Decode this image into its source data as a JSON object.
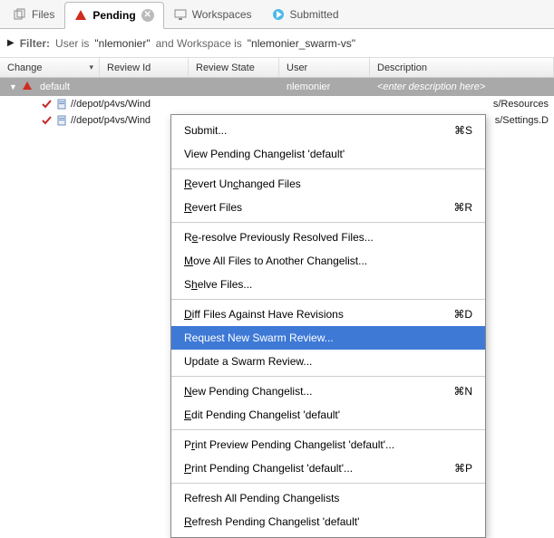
{
  "tabs": {
    "files": "Files",
    "pending": "Pending",
    "workspaces": "Workspaces",
    "submitted": "Submitted"
  },
  "filter": {
    "label": "Filter:",
    "text1": "User is",
    "val1": "\"nlemonier\"",
    "text2": "and Workspace is",
    "val2": "\"nlemonier_swarm-vs\""
  },
  "headers": {
    "change": "Change",
    "review": "Review Id",
    "state": "Review State",
    "user": "User",
    "desc": "Description"
  },
  "group": {
    "name": "default",
    "user": "nlemonier",
    "desc": "<enter description here>"
  },
  "files": [
    {
      "path": "//depot/p4vs/Wind",
      "right": "s/Resources"
    },
    {
      "path": "//depot/p4vs/Wind",
      "right": "s/Settings.D"
    }
  ],
  "menu": {
    "submit": "Submit...",
    "submit_sc": "⌘S",
    "view": "View Pending Changelist 'default'",
    "revert_unchanged": "Revert Unchanged Files",
    "revert": "Revert Files",
    "revert_sc": "⌘R",
    "reresolve": "Re-resolve Previously Resolved Files...",
    "moveall": "Move All Files to Another Changelist...",
    "shelve": "Shelve Files...",
    "diff": "Diff Files Against Have Revisions",
    "diff_sc": "⌘D",
    "request": "Request New Swarm Review...",
    "update": "Update a Swarm Review...",
    "newpending": "New Pending Changelist...",
    "newpending_sc": "⌘N",
    "editpending": "Edit Pending Changelist 'default'",
    "printpreview": "Print Preview Pending Changelist 'default'...",
    "print": "Print Pending Changelist 'default'...",
    "print_sc": "⌘P",
    "refreshall": "Refresh All Pending Changelists",
    "refresh": "Refresh Pending Changelist 'default'"
  }
}
